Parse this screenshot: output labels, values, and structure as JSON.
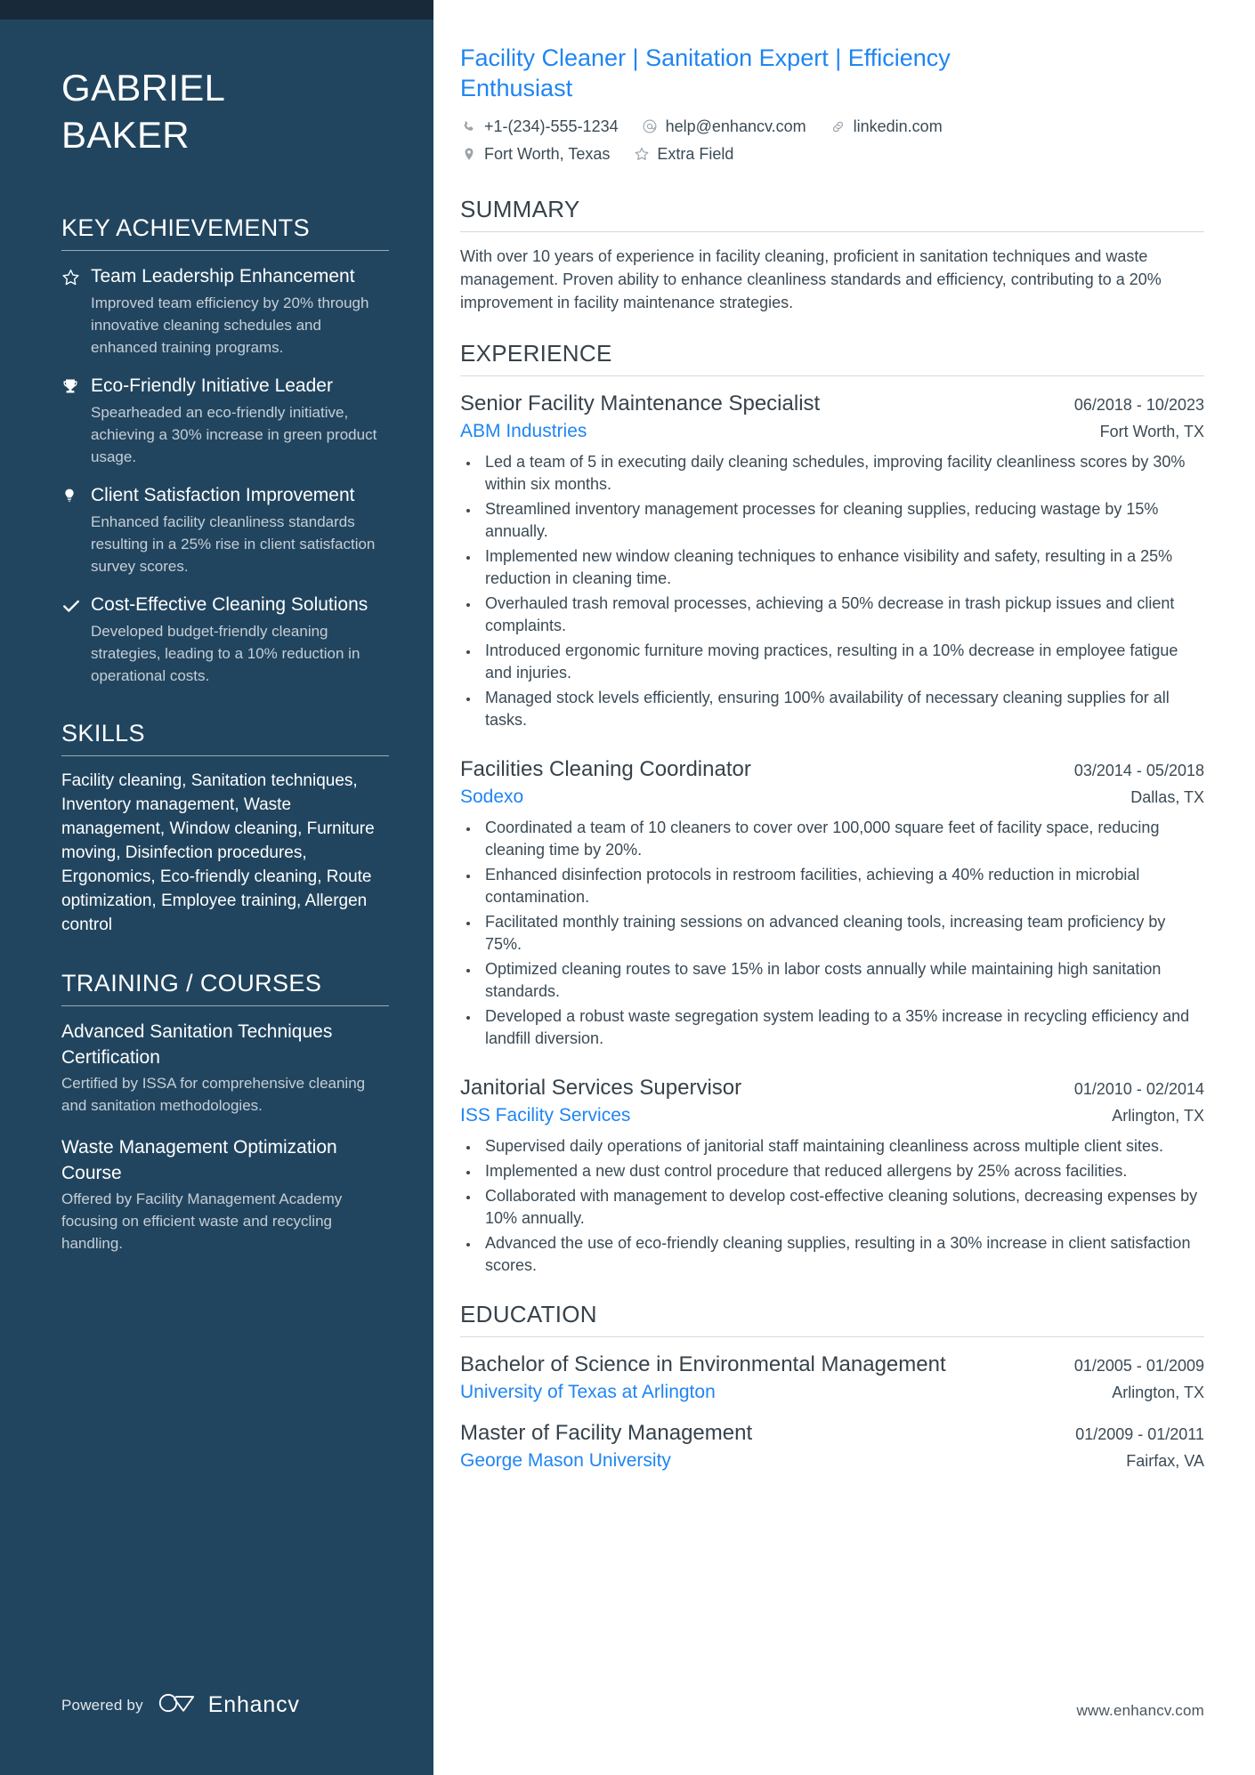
{
  "theme": {
    "sidebar_bg": "#21455f",
    "sidebar_topbar": "#18293a",
    "accent_blue": "#1f85f2",
    "body_text": "#3b4a55",
    "heading_text": "#36424b"
  },
  "sidebar": {
    "name_first": "GABRIEL",
    "name_last": "BAKER",
    "achievements_heading": "KEY ACHIEVEMENTS",
    "achievements": [
      {
        "icon": "star-icon",
        "title": "Team Leadership Enhancement",
        "description": "Improved team efficiency by 20% through innovative cleaning schedules and enhanced training programs."
      },
      {
        "icon": "trophy-icon",
        "title": "Eco-Friendly Initiative Leader",
        "description": "Spearheaded an eco-friendly initiative, achieving a 30% increase in green product usage."
      },
      {
        "icon": "lightbulb-icon",
        "title": "Client Satisfaction Improvement",
        "description": "Enhanced facility cleanliness standards resulting in a 25% rise in client satisfaction survey scores."
      },
      {
        "icon": "check-icon",
        "title": "Cost-Effective Cleaning Solutions",
        "description": "Developed budget-friendly cleaning strategies, leading to a 10% reduction in operational costs."
      }
    ],
    "skills_heading": "SKILLS",
    "skills_text": "Facility cleaning, Sanitation techniques, Inventory management, Waste management, Window cleaning, Furniture moving, Disinfection procedures, Ergonomics, Eco-friendly cleaning, Route optimization, Employee training, Allergen control",
    "training_heading": "TRAINING / COURSES",
    "courses": [
      {
        "title": "Advanced Sanitation Techniques Certification",
        "description": "Certified by ISSA for comprehensive cleaning and sanitation methodologies."
      },
      {
        "title": "Waste Management Optimization Course",
        "description": "Offered by Facility Management Academy focusing on efficient waste and recycling handling."
      }
    ],
    "footer": {
      "powered_by": "Powered by",
      "brand": "Enhancv"
    }
  },
  "main": {
    "headline": "Facility Cleaner | Sanitation Expert | Efficiency Enthusiast",
    "contacts": [
      {
        "icon": "phone-icon",
        "value": "+1-(234)-555-1234"
      },
      {
        "icon": "email-icon",
        "value": "help@enhancv.com"
      },
      {
        "icon": "link-icon",
        "value": "linkedin.com"
      },
      {
        "icon": "location-icon",
        "value": "Fort Worth, Texas"
      },
      {
        "icon": "star-outline-icon",
        "value": "Extra Field"
      }
    ],
    "summary_heading": "SUMMARY",
    "summary_text": "With over 10 years of experience in facility cleaning, proficient in sanitation techniques and waste management. Proven ability to enhance cleanliness standards and efficiency, contributing to a 20% improvement in facility maintenance strategies.",
    "experience_heading": "EXPERIENCE",
    "experience": [
      {
        "title": "Senior Facility Maintenance Specialist",
        "dates": "06/2018 - 10/2023",
        "organization": "ABM Industries",
        "location": "Fort Worth, TX",
        "bullets": [
          "Led a team of 5 in executing daily cleaning schedules, improving facility cleanliness scores by 30% within six months.",
          "Streamlined inventory management processes for cleaning supplies, reducing wastage by 15% annually.",
          "Implemented new window cleaning techniques to enhance visibility and safety, resulting in a 25% reduction in cleaning time.",
          "Overhauled trash removal processes, achieving a 50% decrease in trash pickup issues and client complaints.",
          "Introduced ergonomic furniture moving practices, resulting in a 10% decrease in employee fatigue and injuries.",
          "Managed stock levels efficiently, ensuring 100% availability of necessary cleaning supplies for all tasks."
        ]
      },
      {
        "title": "Facilities Cleaning Coordinator",
        "dates": "03/2014 - 05/2018",
        "organization": "Sodexo",
        "location": "Dallas, TX",
        "bullets": [
          "Coordinated a team of 10 cleaners to cover over 100,000 square feet of facility space, reducing cleaning time by 20%.",
          "Enhanced disinfection protocols in restroom facilities, achieving a 40% reduction in microbial contamination.",
          "Facilitated monthly training sessions on advanced cleaning tools, increasing team proficiency by 75%.",
          "Optimized cleaning routes to save 15% in labor costs annually while maintaining high sanitation standards.",
          "Developed a robust waste segregation system leading to a 35% increase in recycling efficiency and landfill diversion."
        ]
      },
      {
        "title": "Janitorial Services Supervisor",
        "dates": "01/2010 - 02/2014",
        "organization": "ISS Facility Services",
        "location": "Arlington, TX",
        "bullets": [
          "Supervised daily operations of janitorial staff maintaining cleanliness across multiple client sites.",
          "Implemented a new dust control procedure that reduced allergens by 25% across facilities.",
          "Collaborated with management to develop cost-effective cleaning solutions, decreasing expenses by 10% annually.",
          "Advanced the use of eco-friendly cleaning supplies, resulting in a 30% increase in client satisfaction scores."
        ]
      }
    ],
    "education_heading": "EDUCATION",
    "education": [
      {
        "degree": "Bachelor of Science in Environmental Management",
        "dates": "01/2005 - 01/2009",
        "school": "University of Texas at Arlington",
        "location": "Arlington, TX"
      },
      {
        "degree": "Master of Facility Management",
        "dates": "01/2009 - 01/2011",
        "school": "George Mason University",
        "location": "Fairfax, VA"
      }
    ],
    "footer_url": "www.enhancv.com"
  }
}
